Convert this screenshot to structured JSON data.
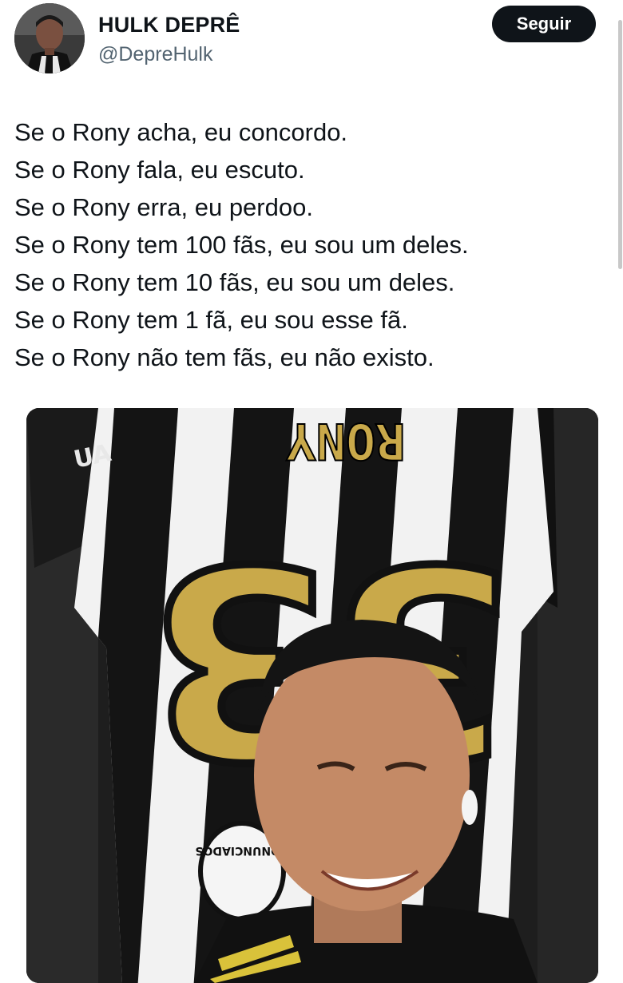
{
  "tweet": {
    "author_name": "HULK DEPRÊ",
    "author_handle": "@DepreHulk",
    "follow_label": "Seguir",
    "lines": [
      "Se o Rony acha, eu concordo.",
      "Se o Rony fala, eu escuto.",
      "Se o Rony erra, eu perdoo.",
      "Se o Rony tem 100 fãs, eu sou um deles.",
      "Se o Rony tem 10 fãs, eu sou um deles.",
      "Se o Rony tem 1 fã, eu sou esse fã.",
      "Se o Rony não tem fãs, eu não existo."
    ]
  },
  "media": {
    "jersey_name": "RONY",
    "jersey_number": "33",
    "sponsor_text": "ADNUNCIADOS",
    "brand_text": "UA"
  },
  "colors": {
    "follow_button": "#0f1419",
    "handle_gray": "#536471",
    "jersey_gold": "#c9a94a"
  }
}
